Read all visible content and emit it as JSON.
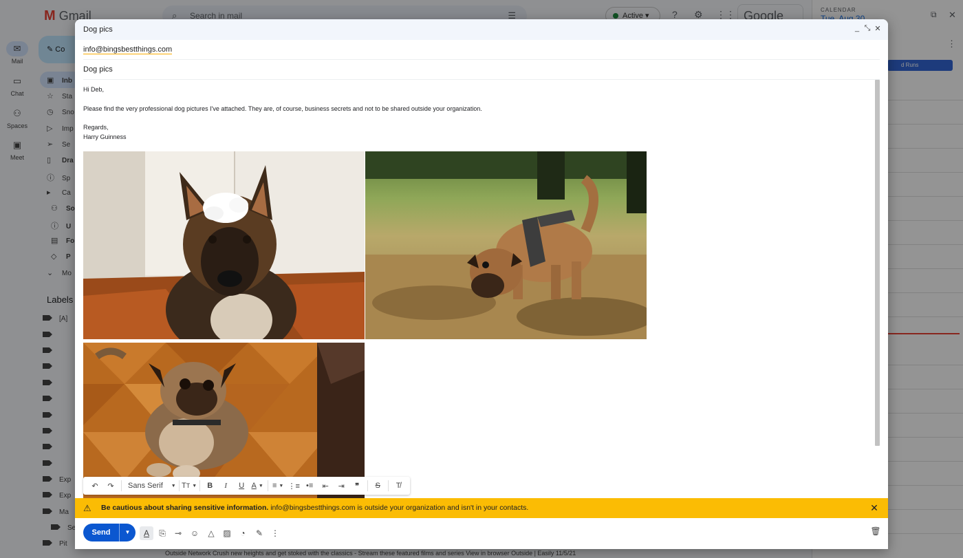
{
  "background": {
    "app_name": "Gmail",
    "search_placeholder": "Search in mail",
    "status": "Active",
    "google_label": "Google",
    "rail": [
      {
        "label": "Mail",
        "icon": "mail-icon"
      },
      {
        "label": "Chat",
        "icon": "chat-icon"
      },
      {
        "label": "Spaces",
        "icon": "spaces-icon"
      },
      {
        "label": "Meet",
        "icon": "meet-icon"
      }
    ],
    "compose_label": "Co",
    "nav": [
      "Inb",
      "Sta",
      "Sno",
      "Imp",
      "Se",
      "Dra",
      "Sp",
      "Ca",
      "So",
      "U",
      "Fo",
      "P",
      "Mo"
    ],
    "labels_title": "Labels",
    "labels": [
      "[A]",
      "",
      "",
      "",
      "",
      "",
      "",
      "",
      "",
      "",
      "",
      "Exp",
      "Exp",
      "Ma",
      "Se",
      "Pit"
    ],
    "calendar": {
      "subtitle": "CALENDAR",
      "date": "Tue, Aug 30",
      "event": "d Runs"
    },
    "bottom_row": "Outside Network      Crush new heights and get stoked with the classics - Stream these featured films and series  View in browser Outside  |  Easily      11/5/21"
  },
  "compose": {
    "title": "Dog pics",
    "to": "info@bingsbestthings.com",
    "subject": "Dog pics",
    "body": {
      "greeting": "Hi Deb,",
      "paragraph": "Please find the very professional dog pictures I've attached. They are, of course, business secrets and not to be shared outside your organization.",
      "closing": "Regards,",
      "signature": "Harry Guinness"
    },
    "images": [
      {
        "alt": "Belgian Malinois with foam on head"
      },
      {
        "alt": "Pug mix sniffing grass"
      },
      {
        "alt": "Pug mix sitting on parquet floor"
      }
    ],
    "toolbar": {
      "font": "Sans Serif"
    },
    "warning": {
      "bold": "Be cautious about sharing sensitive information.",
      "text": " info@bingsbestthings.com is outside your organization and isn't in your contacts."
    },
    "send_label": "Send"
  },
  "colors": {
    "send": "#0b57d0",
    "warning": "#fbbc04",
    "header": "#f2f6fc"
  }
}
